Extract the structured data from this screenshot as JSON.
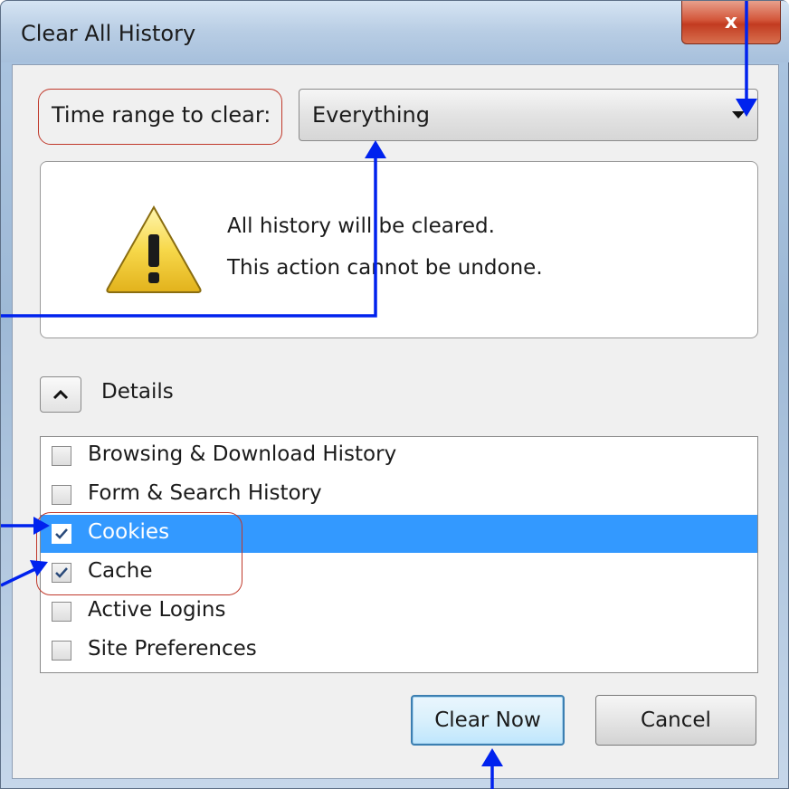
{
  "window": {
    "title": "Clear All History",
    "close_label": "x"
  },
  "time_range": {
    "label": "Time range to clear:",
    "selected": "Everything"
  },
  "warning": {
    "line1": "All history will be cleared.",
    "line2": "This action cannot be undone."
  },
  "details": {
    "label": "Details"
  },
  "items": [
    {
      "label": "Browsing & Download History",
      "checked": false,
      "selected": false
    },
    {
      "label": "Form & Search History",
      "checked": false,
      "selected": false
    },
    {
      "label": "Cookies",
      "checked": true,
      "selected": true
    },
    {
      "label": "Cache",
      "checked": true,
      "selected": false
    },
    {
      "label": "Active Logins",
      "checked": false,
      "selected": false
    },
    {
      "label": "Site Preferences",
      "checked": false,
      "selected": false
    }
  ],
  "buttons": {
    "clear_now": "Clear Now",
    "cancel": "Cancel"
  },
  "colors": {
    "selection": "#3399ff",
    "annotation_arrow": "#0022ee",
    "annotation_circle": "#c0392b"
  }
}
